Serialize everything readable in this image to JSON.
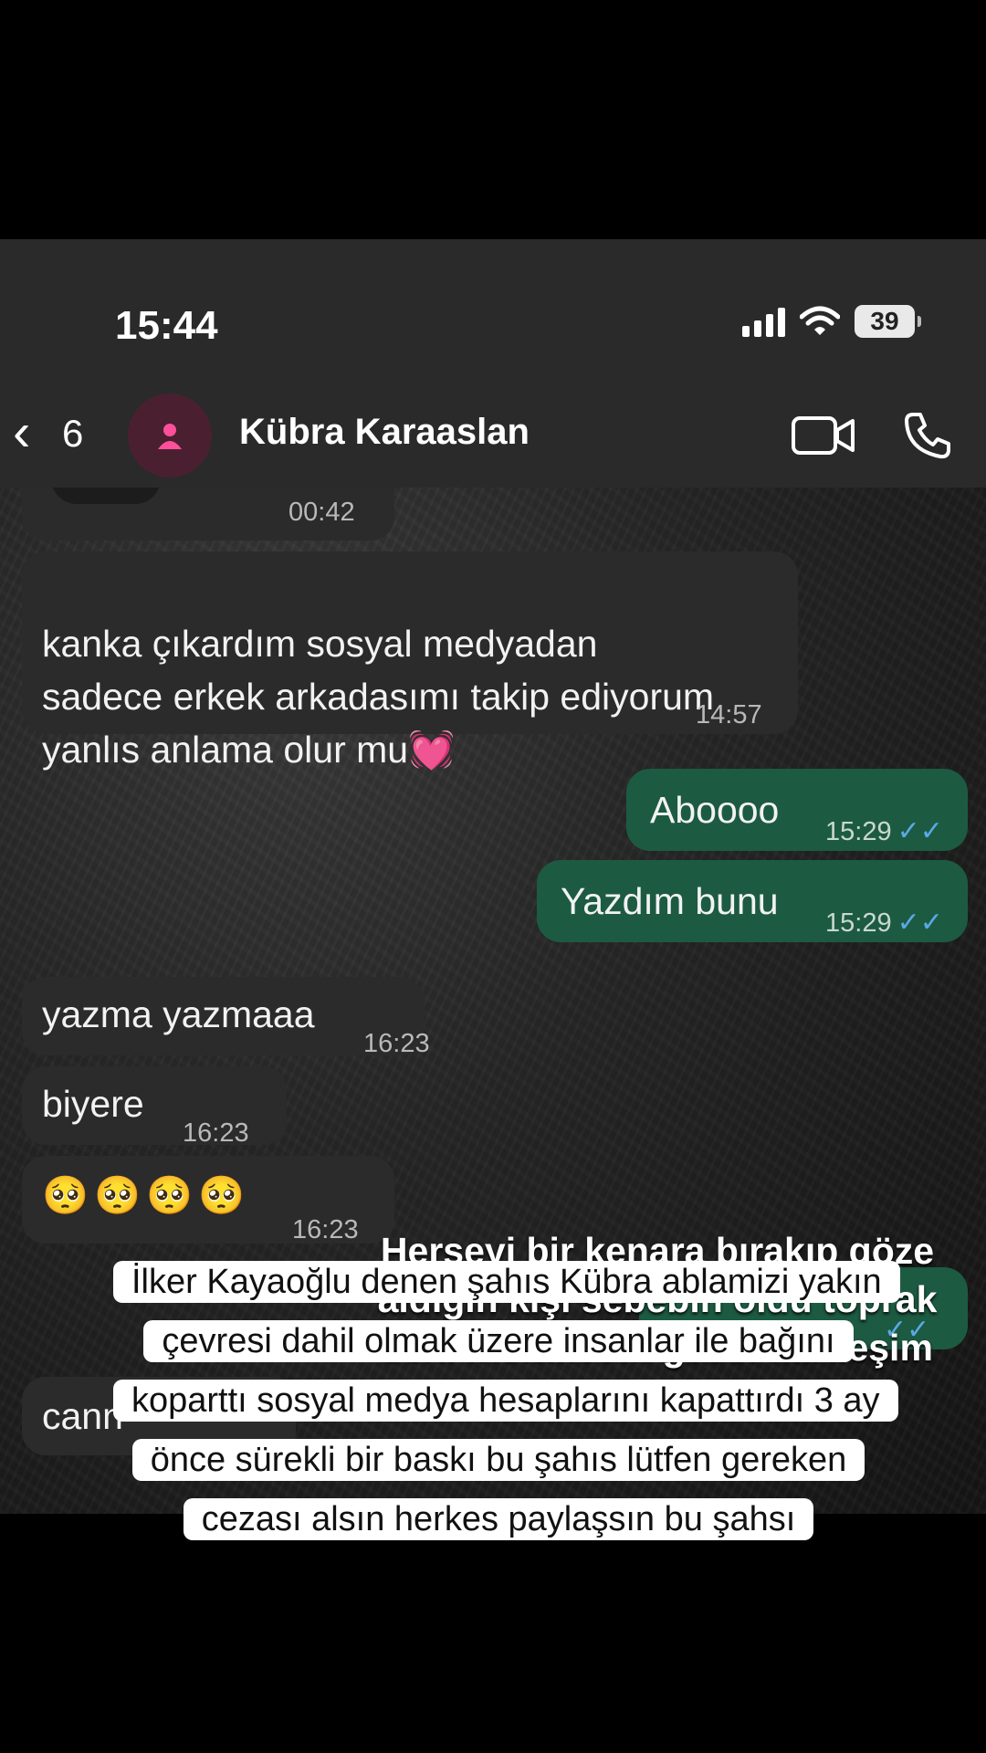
{
  "status_bar": {
    "time": "15:44",
    "battery": "39"
  },
  "header": {
    "back_count": "6",
    "contact_name": "Kübra Karaaslan"
  },
  "messages": [
    {
      "text": "",
      "time": "00:42"
    },
    {
      "text": "kanka çıkardım sosyal medyadan\nsadece erkek arkadasımı takip ediyorum\nyanlıs anlama olur mu",
      "emoji": "💓",
      "time": "14:57"
    },
    {
      "text": "Aboooo",
      "time": "15:29"
    },
    {
      "text": "Yazdım bunu",
      "time": "15:29"
    },
    {
      "text": "yazma yazmaaa",
      "time": "16:23"
    },
    {
      "text": "biyere",
      "time": "16:23"
    },
    {
      "text": "🥺🥺🥺🥺",
      "time": "16:23"
    },
    {
      "text": "cann"
    }
  ],
  "overlay_text": "Herşeyi bir kenara bırakıp göze aldığın kişi sebebin oldu toprak seni incitmesin güzel kardeşim mekanın cennet olsun",
  "caption": "İlker Kayaoğlu denen şahıs Kübra ablamizi yakın çevresi dahil olmak üzere insanlar ile bağını koparttı sosyal medya hesaplarını kapattırdı 3 ay önce sürekli bir baskı bu şahıs lütfen gereken cezası alsın herkes paylaşsın bu şahsı"
}
